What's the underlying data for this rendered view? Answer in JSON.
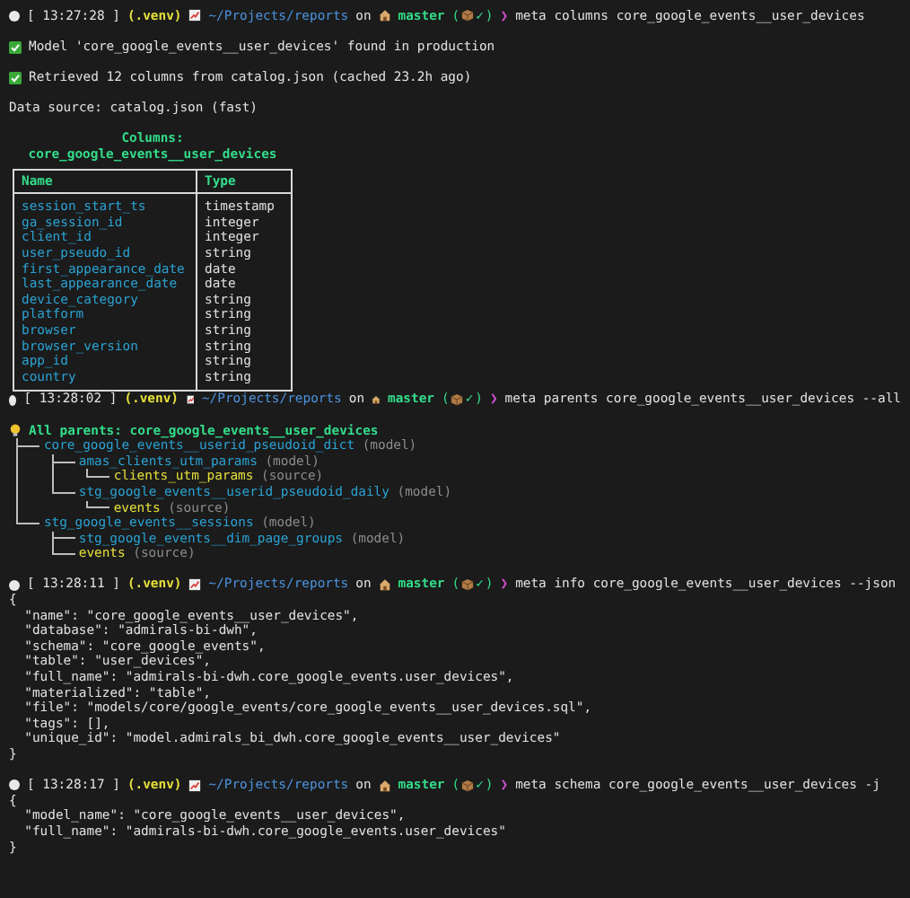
{
  "sessions": [
    {
      "kind": "columns",
      "prompt": {
        "time": "[ 13:27:28 ]",
        "venv": "(.venv)",
        "path": "~/Projects/reports",
        "on": "on",
        "branch": "master",
        "status_open": "(",
        "status_mark": "✓",
        "status_close": ")",
        "arrow": "❯",
        "command": "meta columns core_google_events__user_devices"
      },
      "messages": [
        {
          "kind": "success",
          "text": "Model 'core_google_events__user_devices' found in production"
        },
        {
          "kind": "success",
          "text": "Retrieved 12 columns from catalog.json (cached 23.2h ago)"
        },
        {
          "kind": "plain",
          "text": "Data source: catalog.json (fast)"
        }
      ],
      "table": {
        "title": "Columns:",
        "subtitle": "core_google_events__user_devices",
        "columns": [
          "Name",
          "Type"
        ],
        "rows": [
          [
            "session_start_ts",
            "timestamp"
          ],
          [
            "ga_session_id",
            "integer"
          ],
          [
            "client_id",
            "integer"
          ],
          [
            "user_pseudo_id",
            "string"
          ],
          [
            "first_appearance_date",
            "date"
          ],
          [
            "last_appearance_date",
            "date"
          ],
          [
            "device_category",
            "string"
          ],
          [
            "platform",
            "string"
          ],
          [
            "browser",
            "string"
          ],
          [
            "browser_version",
            "string"
          ],
          [
            "app_id",
            "string"
          ],
          [
            "country",
            "string"
          ]
        ]
      }
    },
    {
      "kind": "parents",
      "prompt": {
        "time": "[ 13:28:02 ]",
        "venv": "(.venv)",
        "path": "~/Projects/reports",
        "on": "on",
        "branch": "master",
        "status_open": "(",
        "status_mark": "✓",
        "status_close": ")",
        "arrow": "❯",
        "command": "meta parents core_google_events__user_devices --all"
      },
      "heading": "All parents: core_google_events__user_devices",
      "tree": [
        {
          "name": "core_google_events__userid_pseudoid_dict",
          "tag": "(model)",
          "kind": "model",
          "children": [
            {
              "name": "amas_clients_utm_params",
              "tag": "(model)",
              "kind": "model",
              "children": [
                {
                  "name": "clients_utm_params",
                  "tag": "(source)",
                  "kind": "source"
                }
              ]
            },
            {
              "name": "stg_google_events__userid_pseudoid_daily",
              "tag": "(model)",
              "kind": "model",
              "children": [
                {
                  "name": "events",
                  "tag": "(source)",
                  "kind": "source"
                }
              ]
            }
          ]
        },
        {
          "name": "stg_google_events__sessions",
          "tag": "(model)",
          "kind": "model",
          "children": [
            {
              "name": "stg_google_events__dim_page_groups",
              "tag": "(model)",
              "kind": "model"
            },
            {
              "name": "events",
              "tag": "(source)",
              "kind": "source"
            }
          ]
        }
      ]
    },
    {
      "kind": "json",
      "prompt": {
        "time": "[ 13:28:11 ]",
        "venv": "(.venv)",
        "path": "~/Projects/reports",
        "on": "on",
        "branch": "master",
        "status_open": "(",
        "status_mark": "✓",
        "status_close": ")",
        "arrow": "❯",
        "command": "meta info core_google_events__user_devices --json"
      },
      "open": "{",
      "entries": [
        "\"name\": \"core_google_events__user_devices\",",
        "\"database\": \"admirals-bi-dwh\",",
        "\"schema\": \"core_google_events\",",
        "\"table\": \"user_devices\",",
        "\"full_name\": \"admirals-bi-dwh.core_google_events.user_devices\",",
        "\"materialized\": \"table\",",
        "\"file\": \"models/core/google_events/core_google_events__user_devices.sql\",",
        "\"tags\": [],",
        "\"unique_id\": \"model.admirals_bi_dwh.core_google_events__user_devices\""
      ],
      "close": "}"
    },
    {
      "kind": "json",
      "prompt": {
        "time": "[ 13:28:17 ]",
        "venv": "(.venv)",
        "path": "~/Projects/reports",
        "on": "on",
        "branch": "master",
        "status_open": "(",
        "status_mark": "✓",
        "status_close": ")",
        "arrow": "❯",
        "command": "meta schema core_google_events__user_devices -j"
      },
      "open": "{",
      "entries": [
        "\"model_name\": \"core_google_events__user_devices\",",
        "\"full_name\": \"admirals-bi-dwh.core_google_events.user_devices\""
      ],
      "close": "}"
    }
  ]
}
